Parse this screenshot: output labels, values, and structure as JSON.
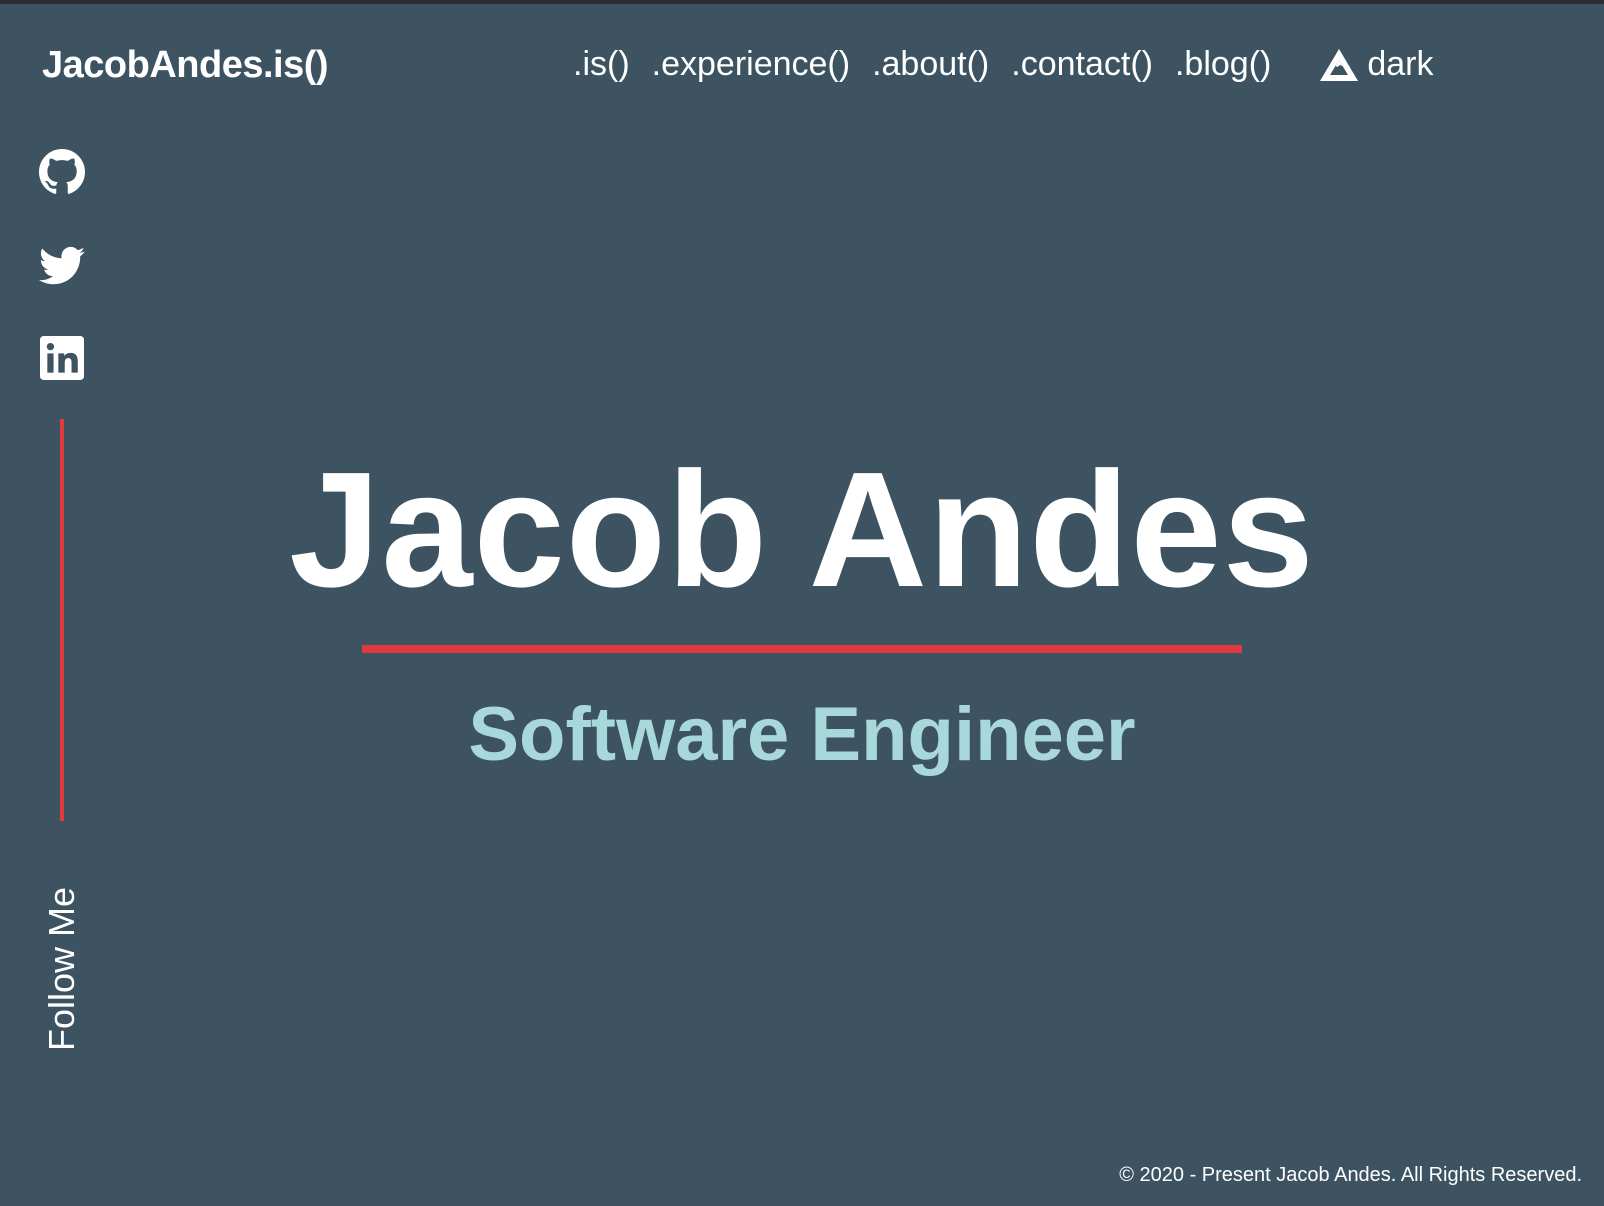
{
  "brand": {
    "label": "JacobAndes.is()"
  },
  "nav": {
    "items": [
      {
        "label": ".is()"
      },
      {
        "label": ".experience()"
      },
      {
        "label": ".about()"
      },
      {
        "label": ".contact()"
      },
      {
        "label": ".blog()"
      }
    ],
    "theme_toggle": {
      "icon": "mountain-icon",
      "label": "dark"
    }
  },
  "social": {
    "links": [
      {
        "icon": "github-icon"
      },
      {
        "icon": "twitter-icon"
      },
      {
        "icon": "linkedin-icon"
      }
    ],
    "follow_label": "Follow Me"
  },
  "hero": {
    "name": "Jacob Andes",
    "role": "Software Engineer"
  },
  "footer": {
    "copyright": "© 2020 - Present Jacob Andes. All Rights Reserved."
  },
  "colors": {
    "background": "#3d5362",
    "accent_red": "#e03a3e",
    "role_teal": "#a8d8dc",
    "text": "#ffffff"
  }
}
